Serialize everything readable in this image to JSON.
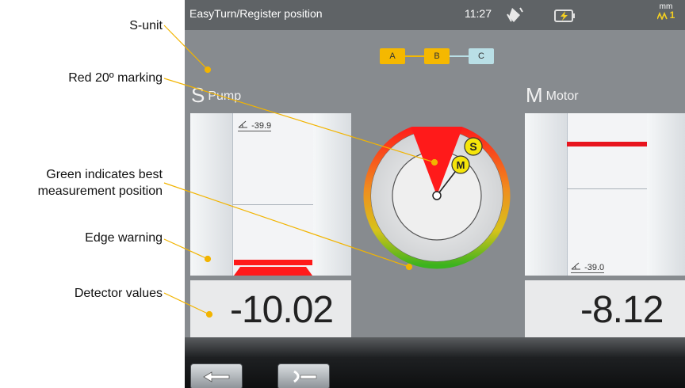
{
  "callouts": {
    "s_unit": "S-unit",
    "red_marking": "Red 20º marking",
    "green_line1": "Green indicates best",
    "green_line2": "measurement position",
    "edge_warning": "Edge warning",
    "detector_values": "Detector values"
  },
  "titlebar": {
    "title": "EasyTurn/Register position",
    "time": "11:27",
    "unit": "mm",
    "range": "1",
    "icons": [
      "rotate-device-icon",
      "battery-charging-icon",
      "signal-range-icon"
    ]
  },
  "steps": {
    "items": [
      {
        "label": "A",
        "color": "#f5b800"
      },
      {
        "label": "B",
        "color": "#f5b800"
      },
      {
        "label": "C",
        "color": "#b9dfe6"
      }
    ]
  },
  "pump": {
    "letter": "S",
    "name": "Pump",
    "angle": "-39.9",
    "value": "-10.02"
  },
  "motor": {
    "letter": "M",
    "name": "Motor",
    "angle": "-39.0",
    "value": "-8.12"
  },
  "dial": {
    "markers": [
      "S",
      "M"
    ],
    "colors": {
      "red": "#ff1a1a",
      "orange": "#f08c1e",
      "green": "#3bb31e",
      "marker": "#f5e50a"
    }
  },
  "nav": {
    "icons": [
      "back-arrow-icon",
      "next-step-icon"
    ]
  }
}
